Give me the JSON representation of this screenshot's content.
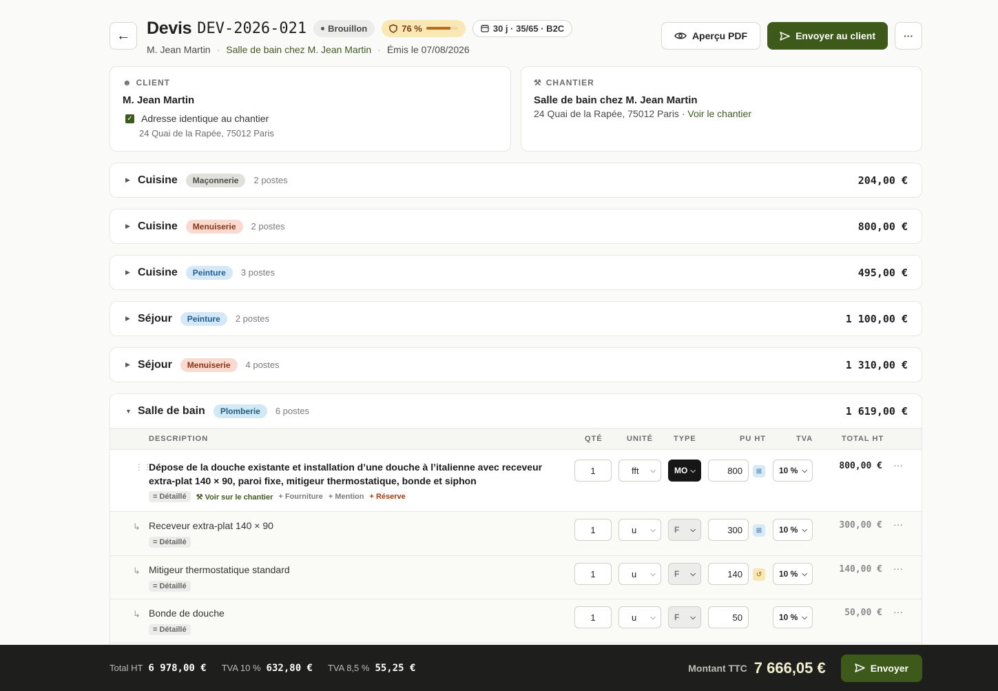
{
  "header": {
    "back_label": "←",
    "title_word": "Devis",
    "title_code": "DEV-2026-021",
    "status": "Brouillon",
    "score": "76 %",
    "score_level": 0.76,
    "meta": "30 j · 35/65 · B2C",
    "client": "M. Jean Martin",
    "chantier_link": "Salle de bain chez M. Jean Martin",
    "issued": "Émis le 07/08/2026",
    "preview_label": "Aperçu PDF",
    "send_label": "Envoyer au client",
    "more_label": "···"
  },
  "client_card": {
    "label": "CLIENT",
    "name": "M. Jean Martin",
    "checkbox_label": "Adresse identique au chantier",
    "address": "24 Quai de la Rapée, 75012 Paris"
  },
  "chantier_card": {
    "label": "CHANTIER",
    "name": "Salle de bain chez M. Jean Martin",
    "address": "24 Quai de la Rapée, 75012 Paris · ",
    "link": "Voir le chantier"
  },
  "sections": [
    {
      "name": "Cuisine",
      "tag": "Maçonnerie",
      "count": "2 postes",
      "total": "204,00 €"
    },
    {
      "name": "Cuisine",
      "tag": "Menuiserie",
      "count": "2 postes",
      "total": "800,00 €"
    },
    {
      "name": "Cuisine",
      "tag": "Peinture",
      "count": "3 postes",
      "total": "495,00 €"
    },
    {
      "name": "Séjour",
      "tag": "Peinture",
      "count": "2 postes",
      "total": "1 100,00 €"
    },
    {
      "name": "Séjour",
      "tag": "Menuiserie",
      "count": "4 postes",
      "total": "1 310,00 €"
    }
  ],
  "expanded": {
    "name": "Salle de bain",
    "tag": "Plomberie",
    "count": "6 postes",
    "total": "1 619,00 €",
    "columns": [
      "DESCRIPTION",
      "QTÉ",
      "UNITÉ",
      "TYPE",
      "PU HT",
      "TVA",
      "TOTAL HT"
    ],
    "rows": [
      {
        "desc": "Dépose de la douche existante et installation d’une douche à l’italienne avec receveur extra-plat 140 × 90, paroi fixe, mitigeur thermostatique, bonde et siphon",
        "qty": "1",
        "unit": "fft",
        "type": "MO",
        "pu": "800",
        "tva": "10 %",
        "total": "800,00 €",
        "detail": "= Détaillé",
        "link_site": "⚒ Voir sur le chantier",
        "link_fourn": "+ Fourniture",
        "link_mention": "+ Mention",
        "link_reserve": "+ Réserve"
      },
      {
        "desc": "Receveur extra-plat 140 × 90",
        "qty": "1",
        "unit": "u",
        "type": "F",
        "pu": "300",
        "tva": "10 %",
        "total": "300,00 €",
        "detail": "= Détaillé"
      },
      {
        "desc": "Mitigeur thermostatique standard",
        "qty": "1",
        "unit": "u",
        "type": "F",
        "pu": "140",
        "tva": "10 %",
        "total": "140,00 €",
        "detail": "= Détaillé"
      },
      {
        "desc": "Bonde de douche",
        "qty": "1",
        "unit": "u",
        "type": "F",
        "pu": "50",
        "tva": "10 %",
        "total": "50,00 €",
        "detail": "= Détaillé"
      }
    ]
  },
  "footer": {
    "ht_label": "Total HT",
    "ht_value": "6 978,00 €",
    "tva10_label": "TVA 10 %",
    "tva10_value": "632,80 €",
    "tva85_label": "TVA 8,5 %",
    "tva85_value": "55,25 €",
    "ttc_label": "Montant TTC",
    "ttc_value": "7 666,05 €",
    "send_label": "Envoyer"
  },
  "colors": {
    "accent": "#3e5a1a",
    "bar": "#1e1e1c"
  }
}
